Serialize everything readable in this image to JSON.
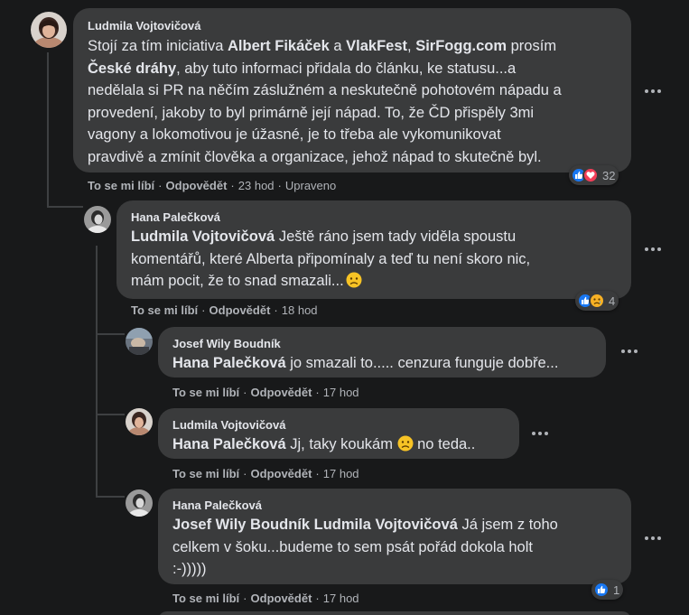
{
  "comments": {
    "c1": {
      "author": "Ludmila Vojtovičová",
      "lines": [
        [
          {
            "t": "Stojí za tím iniciativa ",
            "b": false
          },
          {
            "t": "Albert Fikáček",
            "b": true
          },
          {
            "t": " a ",
            "b": false
          },
          {
            "t": "VlakFest",
            "b": true
          },
          {
            "t": ", ",
            "b": false
          },
          {
            "t": "SirFogg.com",
            "b": true
          },
          {
            "t": " prosím",
            "b": false
          }
        ],
        [
          {
            "t": "České dráhy",
            "b": true
          },
          {
            "t": ", aby tuto informaci přidala do článku, ke statusu...a",
            "b": false
          }
        ],
        [
          {
            "t": "nedělala si PR na něčím záslužném a neskutečně pohotovém nápadu a",
            "b": false
          }
        ],
        [
          {
            "t": "provedení, jakoby to byl primárně její nápad. To, že ČD přispěly 3mi",
            "b": false
          }
        ],
        [
          {
            "t": "vagony a lokomotivou je úžasné, je to třeba ale vykomunikovat",
            "b": false
          }
        ],
        [
          {
            "t": "pravdivě a zmínit člověka a organizace, jehož nápad to skutečně byl.",
            "b": false
          }
        ]
      ],
      "like_label": "To se mi líbí",
      "reply_label": "Odpovědět",
      "time": "23 hod",
      "edited": "Upraveno",
      "reaction_count": "32"
    },
    "c2": {
      "author": "Hana Palečková",
      "lines": [
        [
          {
            "t": "Ludmila Vojtovičová",
            "b": true
          },
          {
            "t": " Ještě ráno jsem tady viděla spoustu",
            "b": false
          }
        ],
        [
          {
            "t": "komentářů, které Alberta připomínaly a teď tu není skoro nic,",
            "b": false
          }
        ],
        [
          {
            "t": "mám pocit, že to snad smazali...",
            "b": false
          }
        ]
      ],
      "like_label": "To se mi líbí",
      "reply_label": "Odpovědět",
      "time": "18 hod",
      "reaction_count": "4"
    },
    "c3": {
      "author": "Josef Wily Boudník",
      "lines": [
        [
          {
            "t": "Hana Palečková",
            "b": true
          },
          {
            "t": " jo smazali to..... cenzura funguje dobře...",
            "b": false
          }
        ]
      ],
      "like_label": "To se mi líbí",
      "reply_label": "Odpovědět",
      "time": "17 hod"
    },
    "c4": {
      "author": "Ludmila Vojtovičová",
      "lines": [
        [
          {
            "t": "Hana Palečková",
            "b": true
          },
          {
            "t": " Jj, taky koukám ",
            "b": false
          },
          {
            "t": "[emoji]",
            "b": false
          },
          {
            "t": " no teda..",
            "b": false
          }
        ]
      ],
      "like_label": "To se mi líbí",
      "reply_label": "Odpovědět",
      "time": "17 hod"
    },
    "c5": {
      "author": "Hana Palečková",
      "lines": [
        [
          {
            "t": "Josef Wily Boudník",
            "b": true
          },
          {
            "t": " ",
            "b": false
          },
          {
            "t": "Ludmila Vojtovičová",
            "b": true
          },
          {
            "t": " Já jsem z toho",
            "b": false
          }
        ],
        [
          {
            "t": "celkem v šoku...budeme to sem psát pořád dokola holt",
            "b": false
          }
        ],
        [
          {
            "t": ":-)))))",
            "b": false
          }
        ]
      ],
      "like_label": "To se mi líbí",
      "reply_label": "Odpovědět",
      "time": "17 hod",
      "reaction_count": "1"
    }
  },
  "icons": {
    "more": "more-horizontal-icon",
    "like": "like-reaction-icon",
    "love": "love-reaction-icon",
    "sad": "sad-reaction-icon",
    "emoji": "sad-face-emoji"
  },
  "colors": {
    "background": "#18191a",
    "bubble": "#3a3b3c",
    "text": "#e4e6eb",
    "secondary_text": "#b0b3b8",
    "like_blue": "#1877f2",
    "love_red": "#f33e58",
    "sad_yellow": "#f7b125"
  }
}
